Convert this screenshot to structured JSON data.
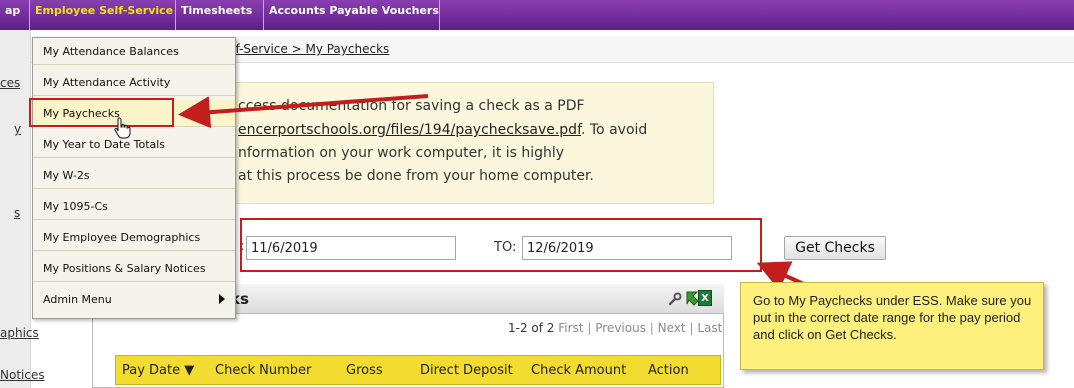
{
  "topbar": {
    "tabs": [
      {
        "label": "ap"
      },
      {
        "label": "Employee Self-Service"
      },
      {
        "label": "Timesheets"
      },
      {
        "label": "Accounts Payable Vouchers"
      }
    ]
  },
  "sidebar": {
    "items": [
      {
        "label": "ces"
      },
      {
        "label": "y"
      },
      {
        "label": "s"
      },
      {
        "label": "aphics"
      },
      {
        "label": "Notices"
      }
    ]
  },
  "breadcrumb": {
    "text": "e Self-Service > My Paychecks"
  },
  "dropdown": {
    "items": [
      {
        "label": "My Attendance Balances"
      },
      {
        "label": "My Attendance Activity"
      },
      {
        "label": "My Paychecks"
      },
      {
        "label": "My Year to Date Totals"
      },
      {
        "label": "My W-2s"
      },
      {
        "label": "My 1095-Cs"
      },
      {
        "label": "My Employee Demographics"
      },
      {
        "label": "My Positions & Salary Notices"
      },
      {
        "label": "Admin Menu"
      }
    ]
  },
  "info": {
    "line1": "ccess documentation for saving a check as a PDF",
    "line2_link": "encerportschools.org/files/194/paychecksave.pdf",
    "line2_rest": ". To avoid",
    "line3": "nformation on your work computer, it is highly",
    "line4": "at this process be done from your home computer."
  },
  "date_range": {
    "from_label": ":",
    "from_value": "11/6/2019",
    "to_label": "TO:",
    "to_value": "12/6/2019",
    "button_label": "Get Checks"
  },
  "panel": {
    "title": "ks",
    "pager": {
      "range": "1-2 of 2",
      "first": "First",
      "previous": "Previous",
      "next": "Next",
      "last": "Last"
    },
    "excel_glyph": "X",
    "columns": [
      "Pay Date ▼",
      "Check Number",
      "Gross",
      "Direct Deposit",
      "Check Amount",
      "Action"
    ]
  },
  "callout": {
    "text": "Go to My Paychecks under ESS.  Make sure you put in the correct date range for the pay period and click on Get Checks."
  },
  "colors": {
    "menu_purple": "#6b2a96",
    "active_tab_text": "#f3e21b",
    "annotation_red": "#c21e1e",
    "table_header_yellow": "#f2dc2f",
    "callout_yellow": "#fdf07d"
  }
}
